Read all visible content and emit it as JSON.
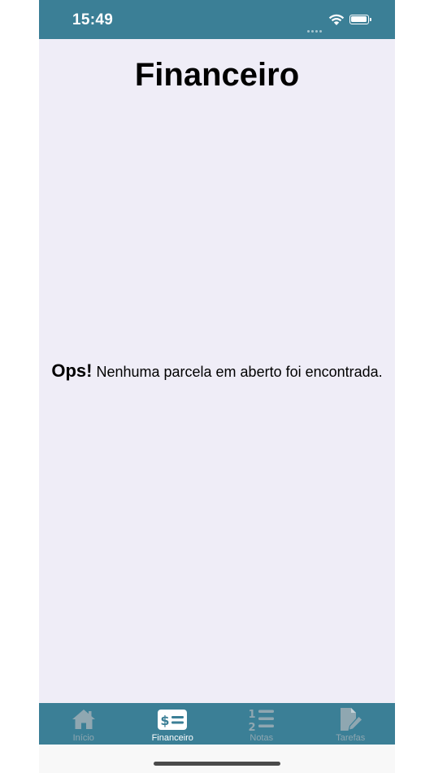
{
  "status_bar": {
    "time": "15:49"
  },
  "header": {
    "title": "Financeiro"
  },
  "empty_state": {
    "emphasis": "Ops!",
    "message": " Nenhuma parcela em aberto foi encontrada."
  },
  "tab_bar": {
    "tabs": [
      {
        "label": "Início",
        "icon": "home-icon",
        "active": false
      },
      {
        "label": "Financeiro",
        "icon": "finance-icon",
        "active": true
      },
      {
        "label": "Notas",
        "icon": "numbered-list-icon",
        "active": false
      },
      {
        "label": "Tarefas",
        "icon": "document-edit-icon",
        "active": false
      }
    ]
  },
  "colors": {
    "accent": "#3b7f96",
    "background": "#efedf7",
    "tab_inactive": "#8fa7b1",
    "tab_active": "#ffffff"
  }
}
